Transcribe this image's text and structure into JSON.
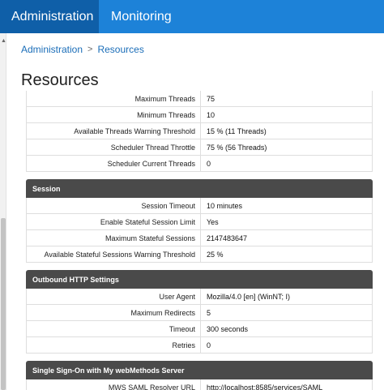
{
  "nav": {
    "tabs": [
      "Administration",
      "Monitoring"
    ]
  },
  "breadcrumb": {
    "root": "Administration",
    "current": "Resources"
  },
  "page_title": "Resources",
  "threads_rows": [
    {
      "label": "Maximum Threads",
      "value": "75"
    },
    {
      "label": "Minimum Threads",
      "value": "10"
    },
    {
      "label": "Available Threads Warning Threshold",
      "value": "15 % (11 Threads)"
    },
    {
      "label": "Scheduler Thread Throttle",
      "value": "75 % (56 Threads)"
    },
    {
      "label": "Scheduler Current Threads",
      "value": "0"
    }
  ],
  "session": {
    "title": "Session",
    "rows": [
      {
        "label": "Session Timeout",
        "value": "10 minutes"
      },
      {
        "label": "Enable Stateful Session Limit",
        "value": "Yes"
      },
      {
        "label": "Maximum Stateful Sessions",
        "value": "2147483647"
      },
      {
        "label": "Available Stateful Sessions Warning Threshold",
        "value": "25 %"
      }
    ]
  },
  "http": {
    "title": "Outbound HTTP Settings",
    "rows": [
      {
        "label": "User Agent",
        "value": "Mozilla/4.0 [en] (WinNT; I)"
      },
      {
        "label": "Maximum Redirects",
        "value": "5"
      },
      {
        "label": "Timeout",
        "value": "300 seconds"
      },
      {
        "label": "Retries",
        "value": "0"
      }
    ]
  },
  "sso": {
    "title": "Single Sign-On with My webMethods Server",
    "rows": [
      {
        "label": "MWS SAML Resolver URL",
        "value": "http://localhost:8585/services/SAML"
      }
    ]
  },
  "colors": {
    "nav_bg": "#1d82d8",
    "nav_active": "#0f5fa8",
    "section_header": "#4a4a4a",
    "link": "#1a6db8"
  }
}
